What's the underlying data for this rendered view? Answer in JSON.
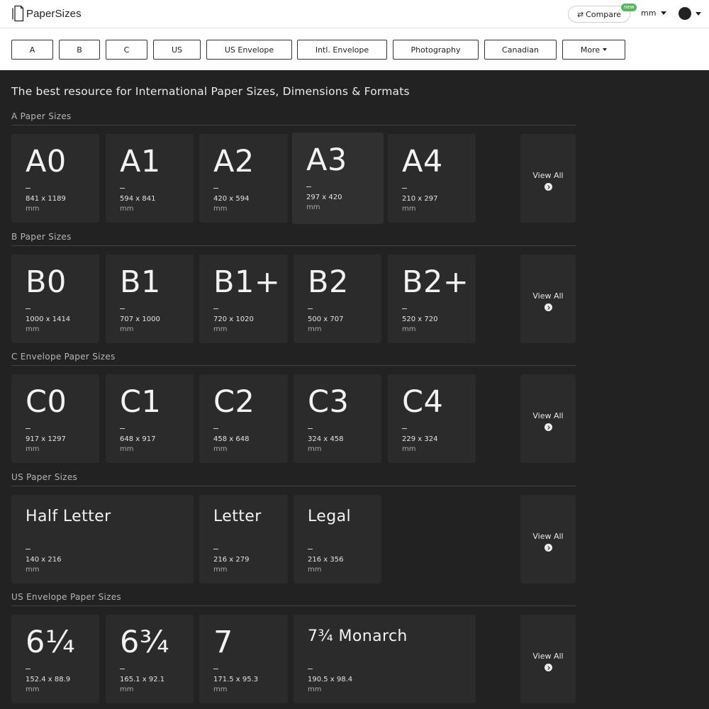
{
  "header": {
    "logo_text": "PaperSizes",
    "compare_label": "Compare",
    "compare_badge": "new",
    "unit": "mm"
  },
  "nav": [
    "A",
    "B",
    "C",
    "US",
    "US Envelope",
    "Intl. Envelope",
    "Photography",
    "Canadian",
    "More"
  ],
  "headline": "The best resource for International Paper Sizes, Dimensions & Formats",
  "view_all_label": "View All",
  "sections": [
    {
      "title": "A Paper Sizes",
      "cards": [
        {
          "name": "A0",
          "dims": "841 x 1189",
          "unit": "mm"
        },
        {
          "name": "A1",
          "dims": "594 x 841",
          "unit": "mm"
        },
        {
          "name": "A2",
          "dims": "420 x 594",
          "unit": "mm"
        },
        {
          "name": "A3",
          "dims": "297 x 420",
          "unit": "mm"
        },
        {
          "name": "A4",
          "dims": "210 x 297",
          "unit": "mm"
        }
      ]
    },
    {
      "title": "B Paper Sizes",
      "cards": [
        {
          "name": "B0",
          "dims": "1000 x 1414",
          "unit": "mm"
        },
        {
          "name": "B1",
          "dims": "707 x 1000",
          "unit": "mm"
        },
        {
          "name": "B1+",
          "dims": "720 x 1020",
          "unit": "mm"
        },
        {
          "name": "B2",
          "dims": "500 x 707",
          "unit": "mm"
        },
        {
          "name": "B2+",
          "dims": "520 x 720",
          "unit": "mm"
        }
      ]
    },
    {
      "title": "C Envelope Paper Sizes",
      "cards": [
        {
          "name": "C0",
          "dims": "917 x 1297",
          "unit": "mm"
        },
        {
          "name": "C1",
          "dims": "648 x 917",
          "unit": "mm"
        },
        {
          "name": "C2",
          "dims": "458 x 648",
          "unit": "mm"
        },
        {
          "name": "C3",
          "dims": "324 x 458",
          "unit": "mm"
        },
        {
          "name": "C4",
          "dims": "229 x 324",
          "unit": "mm"
        }
      ]
    },
    {
      "title": "US Paper Sizes",
      "cards": [
        {
          "name": "Half Letter",
          "dims": "140 x 216",
          "unit": "mm"
        },
        {
          "name": "Letter",
          "dims": "216 x 279",
          "unit": "mm"
        },
        {
          "name": "Legal",
          "dims": "216 x 356",
          "unit": "mm"
        }
      ]
    },
    {
      "title": "US Envelope Paper Sizes",
      "cards": [
        {
          "name": "6¼",
          "dims": "152.4 x 88.9",
          "unit": "mm"
        },
        {
          "name": "6¾",
          "dims": "165.1 x 92.1",
          "unit": "mm"
        },
        {
          "name": "7",
          "dims": "171.5 x 95.3",
          "unit": "mm"
        },
        {
          "name": "7¾ Monarch",
          "dims": "190.5 x 98.4",
          "unit": "mm"
        }
      ]
    }
  ]
}
